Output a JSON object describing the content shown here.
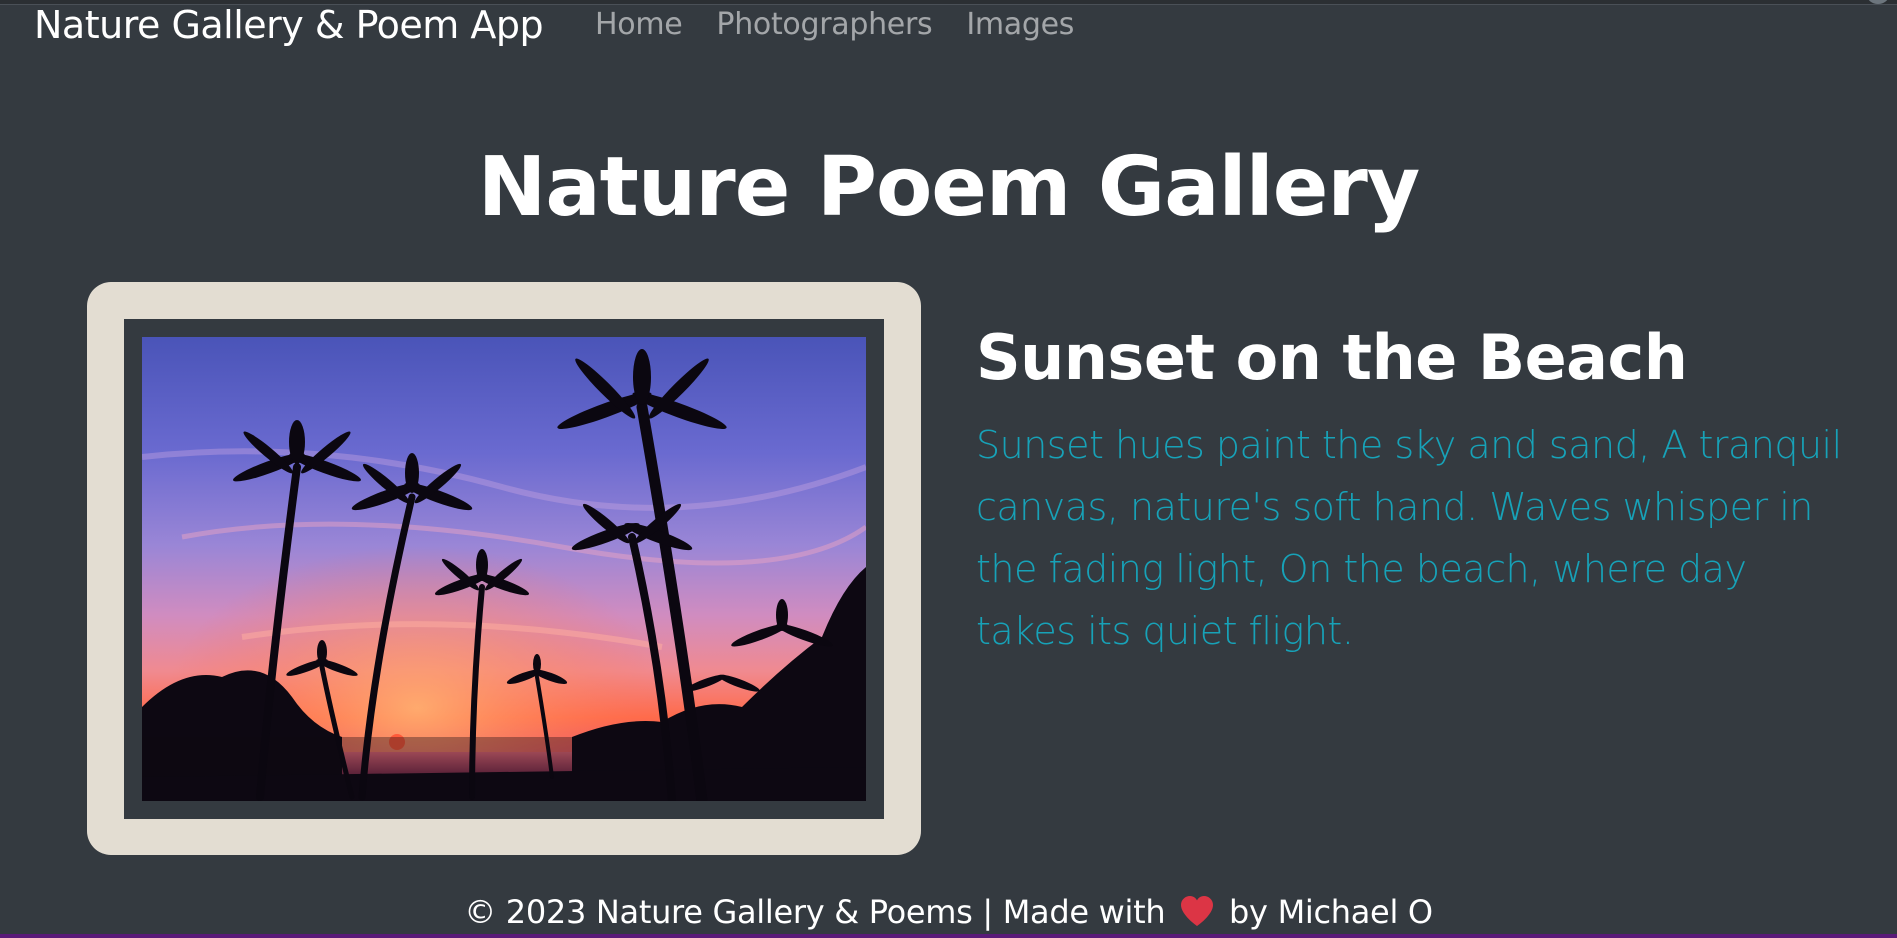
{
  "navbar": {
    "brand": "Nature Gallery & Poem App",
    "links": [
      {
        "label": "Home"
      },
      {
        "label": "Photographers"
      },
      {
        "label": "Images"
      }
    ]
  },
  "page": {
    "title": "Nature Poem Gallery"
  },
  "artwork": {
    "image_alt": "Palm trees silhouetted against a sunset sky over the beach",
    "title": "Sunset on the Beach",
    "poem": "Sunset hues paint the sky and sand, A tranquil canvas, nature's soft hand. Waves whisper in the fading light, On the beach, where day takes its quiet flight."
  },
  "footer": {
    "prefix": "© 2023 Nature Gallery & Poems | Made with",
    "icon": "heart-icon",
    "suffix": "by Michael O"
  },
  "colors": {
    "background": "#343a40",
    "frame": "#e3ddd2",
    "poem_text": "#17a2b8",
    "heart": "#dc3545"
  }
}
